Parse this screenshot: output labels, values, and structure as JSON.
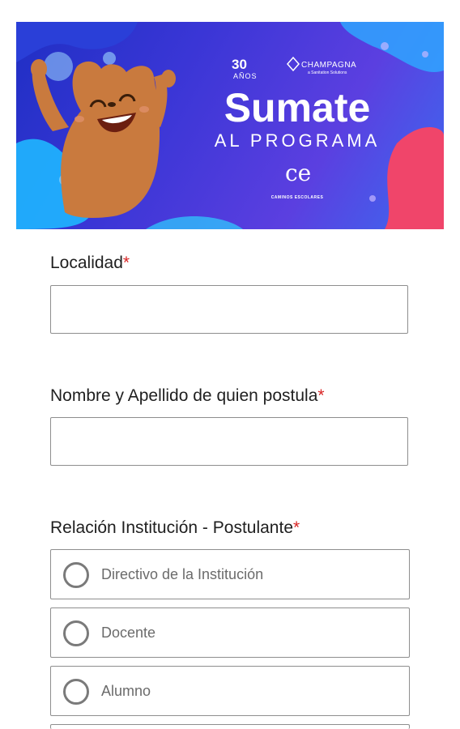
{
  "banner": {
    "title": "Sumate",
    "subtitle": "AL PROGRAMA",
    "logo_30": "30",
    "logo_anos": "AÑOS",
    "brand": "CHAMPAGNA",
    "brand_sub": "a Sanitation Solutions",
    "ce_mark": "ce",
    "caminos": "CAMINOS ESCOLARES"
  },
  "form": {
    "localidad": {
      "label": "Localidad",
      "required_mark": "*",
      "value": ""
    },
    "nombre": {
      "label": "Nombre y Apellido de quien postula",
      "required_mark": "*",
      "value": ""
    },
    "relacion": {
      "label": "Relación Institución - Postulante",
      "required_mark": "*",
      "options": [
        {
          "label": "Directivo de la Institución"
        },
        {
          "label": "Docente"
        },
        {
          "label": "Alumno"
        }
      ]
    }
  },
  "colors": {
    "required": "#d92525",
    "banner_blue": "#3a36d6",
    "mascot": "#c97a3e"
  }
}
